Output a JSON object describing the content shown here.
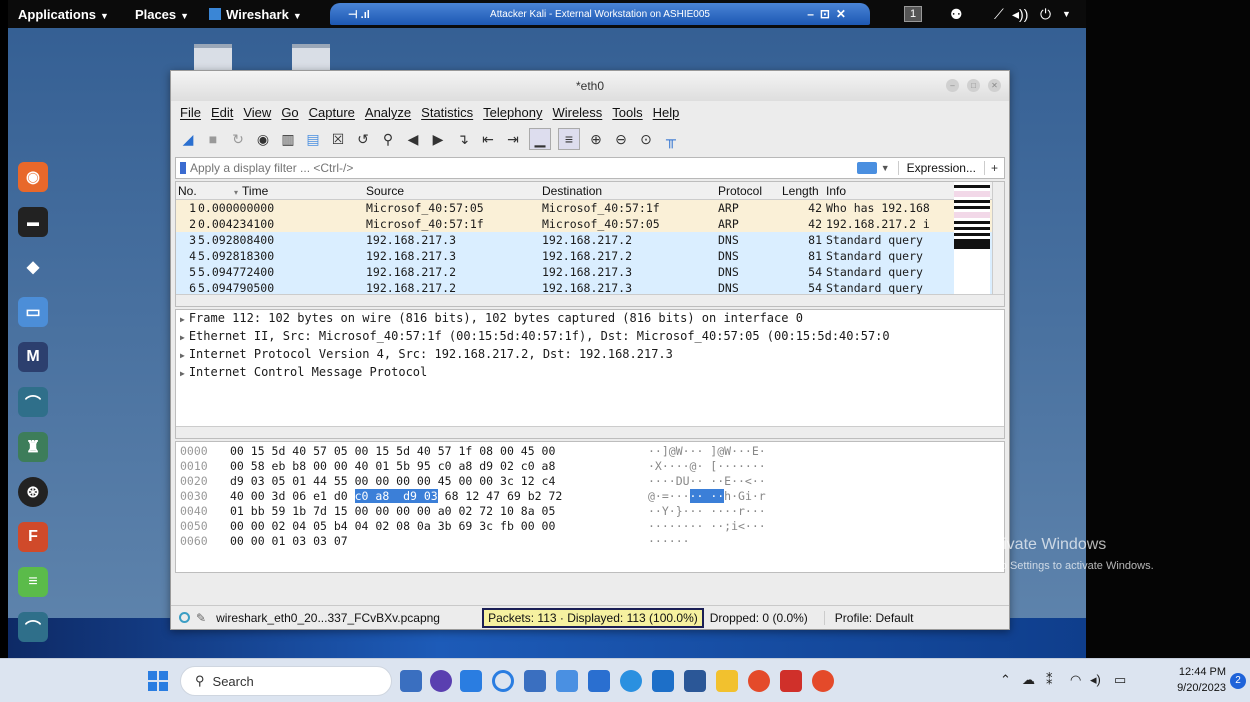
{
  "kali_panel": {
    "menus": [
      "Applications",
      "Places",
      "Wireshark"
    ],
    "vm_title": "Attacker Kali - External Workstation on ASHIE005",
    "workspace": "1"
  },
  "wireshark": {
    "window_title": "*eth0",
    "menu": [
      "File",
      "Edit",
      "View",
      "Go",
      "Capture",
      "Analyze",
      "Statistics",
      "Telephony",
      "Wireless",
      "Tools",
      "Help"
    ],
    "filter": {
      "placeholder": "Apply a display filter ... <Ctrl-/>",
      "expression_label": "Expression...",
      "plus_label": "+"
    },
    "columns": {
      "no": "No.",
      "time": "Time",
      "source": "Source",
      "destination": "Destination",
      "protocol": "Protocol",
      "length": "Length",
      "info": "Info"
    },
    "packets": [
      {
        "no": "1",
        "time": "0.000000000",
        "source": "Microsof_40:57:05",
        "destination": "Microsof_40:57:1f",
        "protocol": "ARP",
        "length": "42",
        "info": "Who has 192.168"
      },
      {
        "no": "2",
        "time": "0.004234100",
        "source": "Microsof_40:57:1f",
        "destination": "Microsof_40:57:05",
        "protocol": "ARP",
        "length": "42",
        "info": "192.168.217.2 i"
      },
      {
        "no": "3",
        "time": "5.092808400",
        "source": "192.168.217.3",
        "destination": "192.168.217.2",
        "protocol": "DNS",
        "length": "81",
        "info": "Standard query"
      },
      {
        "no": "4",
        "time": "5.092818300",
        "source": "192.168.217.3",
        "destination": "192.168.217.2",
        "protocol": "DNS",
        "length": "81",
        "info": "Standard query"
      },
      {
        "no": "5",
        "time": "5.094772400",
        "source": "192.168.217.2",
        "destination": "192.168.217.3",
        "protocol": "DNS",
        "length": "54",
        "info": "Standard query"
      },
      {
        "no": "6",
        "time": "5.094790500",
        "source": "192.168.217.2",
        "destination": "192.168.217.3",
        "protocol": "DNS",
        "length": "54",
        "info": "Standard query"
      }
    ],
    "details": [
      "Frame 112: 102 bytes on wire (816 bits), 102 bytes captured (816 bits) on interface 0",
      "Ethernet II, Src: Microsof_40:57:1f (00:15:5d:40:57:1f), Dst: Microsof_40:57:05 (00:15:5d:40:57:0",
      "Internet Protocol Version 4, Src: 192.168.217.2, Dst: 192.168.217.3",
      "Internet Control Message Protocol"
    ],
    "bytes": [
      {
        "offset": "0000",
        "hex_a": "00 15 5d 40 57 05 00 15  5d 40 57 1f 08 00 45 00",
        "sel": "",
        "hex_b": "",
        "ascii_a": "··]@W··· ]@W···E·",
        "ascii_sel": "",
        "ascii_b": ""
      },
      {
        "offset": "0010",
        "hex_a": "00 58 eb b8 00 00 40 01  5b 95 c0 a8 d9 02 c0 a8",
        "sel": "",
        "hex_b": "",
        "ascii_a": "·X····@· [·······",
        "ascii_sel": "",
        "ascii_b": ""
      },
      {
        "offset": "0020",
        "hex_a": "d9 03 05 01 44 55 00 00  00 00 45 00 00 3c 12 c4",
        "sel": "",
        "hex_b": "",
        "ascii_a": "····DU·· ··E··<··",
        "ascii_sel": "",
        "ascii_b": ""
      },
      {
        "offset": "0030",
        "hex_a": "40 00 3d 06 e1 d0 ",
        "sel": "c0 a8  d9 03",
        "hex_b": " 68 12 47 69 b2 72",
        "ascii_a": "@·=···",
        "ascii_sel": "·· ··",
        "ascii_b": "h·Gi·r"
      },
      {
        "offset": "0040",
        "hex_a": "01 bb 59 1b 7d 15 00 00  00 00 a0 02 72 10 8a 05",
        "sel": "",
        "hex_b": "",
        "ascii_a": "··Y·}··· ····r···",
        "ascii_sel": "",
        "ascii_b": ""
      },
      {
        "offset": "0050",
        "hex_a": "00 00 02 04 05 b4 04 02  08 0a 3b 69 3c fb 00 00",
        "sel": "",
        "hex_b": "",
        "ascii_a": "········ ··;i<···",
        "ascii_sel": "",
        "ascii_b": ""
      },
      {
        "offset": "0060",
        "hex_a": "00 00 01 03 03 07",
        "sel": "",
        "hex_b": "",
        "ascii_a": "······",
        "ascii_sel": "",
        "ascii_b": ""
      }
    ],
    "status": {
      "file": "wireshark_eth0_20...337_FCvBXv.pcapng",
      "packets": "Packets: 113 · Displayed: 113 (100.0%)",
      "dropped": "Dropped: 0 (0.0%)",
      "profile": "Profile: Default"
    }
  },
  "activate_windows": {
    "title": "Activate Windows",
    "subtitle": "Go to Settings to activate Windows."
  },
  "taskbar": {
    "search_label": "Search",
    "time": "12:44 PM",
    "date": "9/20/2023",
    "notification_count": "2"
  },
  "colors": {
    "arp_row": "#faf0d7",
    "dns_row": "#daeeff",
    "selection": "#3b7fd8",
    "status_highlight": "#f6f1a0"
  }
}
